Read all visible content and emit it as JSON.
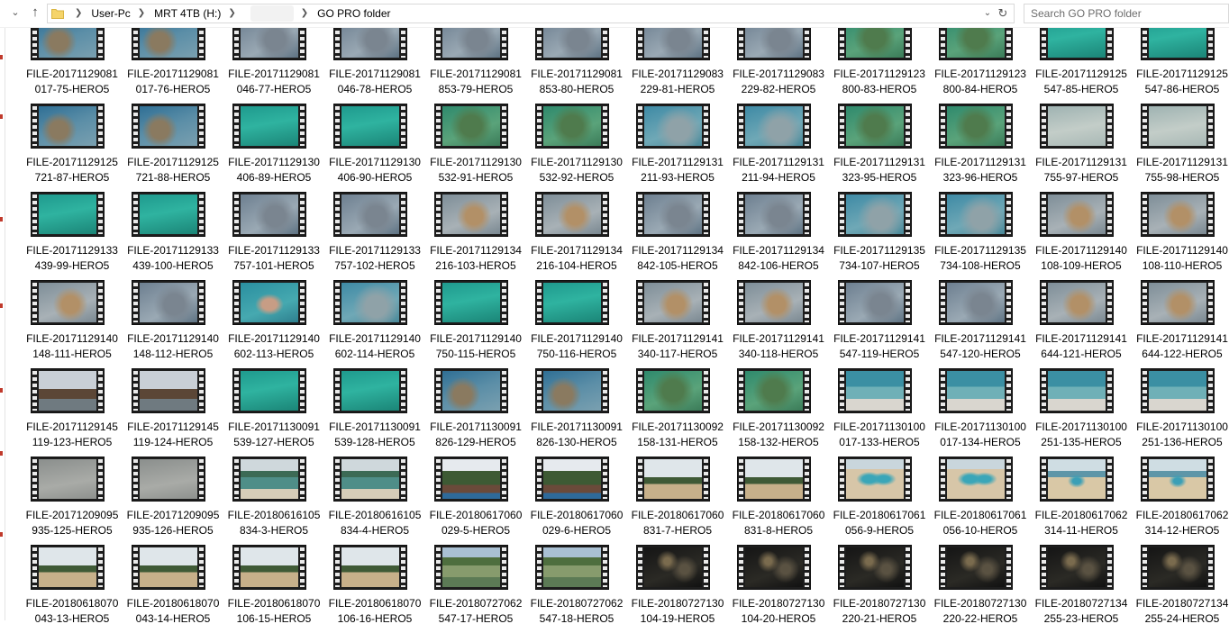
{
  "address_bar": {
    "breadcrumbs": [
      "User-Pc",
      "MRT 4TB (H:)",
      "GO PRO folder"
    ]
  },
  "search": {
    "placeholder": "Search GO PRO folder"
  },
  "files": [
    {
      "name": [
        "FILE-20171129081",
        "017-75-HERO5"
      ],
      "thumb": "reef"
    },
    {
      "name": [
        "FILE-20171129081",
        "017-76-HERO5"
      ],
      "thumb": "reef"
    },
    {
      "name": [
        "FILE-20171129081",
        "046-77-HERO5"
      ],
      "thumb": "rocks"
    },
    {
      "name": [
        "FILE-20171129081",
        "046-78-HERO5"
      ],
      "thumb": "rocks"
    },
    {
      "name": [
        "FILE-20171129081",
        "853-79-HERO5"
      ],
      "thumb": "rocks"
    },
    {
      "name": [
        "FILE-20171129081",
        "853-80-HERO5"
      ],
      "thumb": "rocks"
    },
    {
      "name": [
        "FILE-20171129083",
        "229-81-HERO5"
      ],
      "thumb": "rocks"
    },
    {
      "name": [
        "FILE-20171129083",
        "229-82-HERO5"
      ],
      "thumb": "rocks"
    },
    {
      "name": [
        "FILE-20171129123",
        "800-83-HERO5"
      ],
      "thumb": "green"
    },
    {
      "name": [
        "FILE-20171129123",
        "800-84-HERO5"
      ],
      "thumb": "green"
    },
    {
      "name": [
        "FILE-20171129125",
        "547-85-HERO5"
      ],
      "thumb": "teal"
    },
    {
      "name": [
        "FILE-20171129125",
        "547-86-HERO5"
      ],
      "thumb": "teal"
    },
    {
      "name": [
        "FILE-20171129125",
        "721-87-HERO5"
      ],
      "thumb": "reef"
    },
    {
      "name": [
        "FILE-20171129125",
        "721-88-HERO5"
      ],
      "thumb": "reef"
    },
    {
      "name": [
        "FILE-20171129130",
        "406-89-HERO5"
      ],
      "thumb": "teal"
    },
    {
      "name": [
        "FILE-20171129130",
        "406-90-HERO5"
      ],
      "thumb": "teal"
    },
    {
      "name": [
        "FILE-20171129130",
        "532-91-HERO5"
      ],
      "thumb": "green"
    },
    {
      "name": [
        "FILE-20171129130",
        "532-92-HERO5"
      ],
      "thumb": "green"
    },
    {
      "name": [
        "FILE-20171129131",
        "211-93-HERO5"
      ],
      "thumb": "water"
    },
    {
      "name": [
        "FILE-20171129131",
        "211-94-HERO5"
      ],
      "thumb": "water"
    },
    {
      "name": [
        "FILE-20171129131",
        "323-95-HERO5"
      ],
      "thumb": "green"
    },
    {
      "name": [
        "FILE-20171129131",
        "323-96-HERO5"
      ],
      "thumb": "green"
    },
    {
      "name": [
        "FILE-20171129131",
        "755-97-HERO5"
      ],
      "thumb": "sand"
    },
    {
      "name": [
        "FILE-20171129131",
        "755-98-HERO5"
      ],
      "thumb": "sand"
    },
    {
      "name": [
        "FILE-20171129133",
        "439-99-HERO5"
      ],
      "thumb": "teal"
    },
    {
      "name": [
        "FILE-20171129133",
        "439-100-HERO5"
      ],
      "thumb": "teal"
    },
    {
      "name": [
        "FILE-20171129133",
        "757-101-HERO5"
      ],
      "thumb": "rocks"
    },
    {
      "name": [
        "FILE-20171129133",
        "757-102-HERO5"
      ],
      "thumb": "rocks"
    },
    {
      "name": [
        "FILE-20171129134",
        "216-103-HERO5"
      ],
      "thumb": "coral"
    },
    {
      "name": [
        "FILE-20171129134",
        "216-104-HERO5"
      ],
      "thumb": "coral"
    },
    {
      "name": [
        "FILE-20171129134",
        "842-105-HERO5"
      ],
      "thumb": "rocks"
    },
    {
      "name": [
        "FILE-20171129134",
        "842-106-HERO5"
      ],
      "thumb": "rocks"
    },
    {
      "name": [
        "FILE-20171129135",
        "734-107-HERO5"
      ],
      "thumb": "water"
    },
    {
      "name": [
        "FILE-20171129135",
        "734-108-HERO5"
      ],
      "thumb": "water"
    },
    {
      "name": [
        "FILE-20171129140",
        "108-109-HERO5"
      ],
      "thumb": "coral"
    },
    {
      "name": [
        "FILE-20171129140",
        "108-110-HERO5"
      ],
      "thumb": "coral"
    },
    {
      "name": [
        "FILE-20171129140",
        "148-111-HERO5"
      ],
      "thumb": "coral"
    },
    {
      "name": [
        "FILE-20171129140",
        "148-112-HERO5"
      ],
      "thumb": "rocks"
    },
    {
      "name": [
        "FILE-20171129140",
        "602-113-HERO5"
      ],
      "thumb": "swimmer"
    },
    {
      "name": [
        "FILE-20171129140",
        "602-114-HERO5"
      ],
      "thumb": "water"
    },
    {
      "name": [
        "FILE-20171129140",
        "750-115-HERO5"
      ],
      "thumb": "teal"
    },
    {
      "name": [
        "FILE-20171129140",
        "750-116-HERO5"
      ],
      "thumb": "teal"
    },
    {
      "name": [
        "FILE-20171129141",
        "340-117-HERO5"
      ],
      "thumb": "coral"
    },
    {
      "name": [
        "FILE-20171129141",
        "340-118-HERO5"
      ],
      "thumb": "coral"
    },
    {
      "name": [
        "FILE-20171129141",
        "547-119-HERO5"
      ],
      "thumb": "rocks"
    },
    {
      "name": [
        "FILE-20171129141",
        "547-120-HERO5"
      ],
      "thumb": "rocks"
    },
    {
      "name": [
        "FILE-20171129141",
        "644-121-HERO5"
      ],
      "thumb": "coral"
    },
    {
      "name": [
        "FILE-20171129141",
        "644-122-HERO5"
      ],
      "thumb": "coral"
    },
    {
      "name": [
        "FILE-20171129145",
        "119-123-HERO5"
      ],
      "thumb": "villa"
    },
    {
      "name": [
        "FILE-20171129145",
        "119-124-HERO5"
      ],
      "thumb": "villa"
    },
    {
      "name": [
        "FILE-20171130091",
        "539-127-HERO5"
      ],
      "thumb": "teal"
    },
    {
      "name": [
        "FILE-20171130091",
        "539-128-HERO5"
      ],
      "thumb": "teal"
    },
    {
      "name": [
        "FILE-20171130091",
        "826-129-HERO5"
      ],
      "thumb": "reef"
    },
    {
      "name": [
        "FILE-20171130091",
        "826-130-HERO5"
      ],
      "thumb": "reef"
    },
    {
      "name": [
        "FILE-20171130092",
        "158-131-HERO5"
      ],
      "thumb": "green"
    },
    {
      "name": [
        "FILE-20171130092",
        "158-132-HERO5"
      ],
      "thumb": "green"
    },
    {
      "name": [
        "FILE-20171130100",
        "017-133-HERO5"
      ],
      "thumb": "shore"
    },
    {
      "name": [
        "FILE-20171130100",
        "017-134-HERO5"
      ],
      "thumb": "shore"
    },
    {
      "name": [
        "FILE-20171130100",
        "251-135-HERO5"
      ],
      "thumb": "shore"
    },
    {
      "name": [
        "FILE-20171130100",
        "251-136-HERO5"
      ],
      "thumb": "shore"
    },
    {
      "name": [
        "FILE-20171209095",
        "935-125-HERO5"
      ],
      "thumb": "grey"
    },
    {
      "name": [
        "FILE-20171209095",
        "935-126-HERO5"
      ],
      "thumb": "grey"
    },
    {
      "name": [
        "FILE-20180616105",
        "834-3-HERO5"
      ],
      "thumb": "lagoon"
    },
    {
      "name": [
        "FILE-20180616105",
        "834-4-HERO5"
      ],
      "thumb": "lagoon"
    },
    {
      "name": [
        "FILE-20180617060",
        "029-5-HERO5"
      ],
      "thumb": "resort"
    },
    {
      "name": [
        "FILE-20180617060",
        "029-6-HERO5"
      ],
      "thumb": "resort"
    },
    {
      "name": [
        "FILE-20180617060",
        "831-7-HERO5"
      ],
      "thumb": "palms"
    },
    {
      "name": [
        "FILE-20180617060",
        "831-8-HERO5"
      ],
      "thumb": "palms"
    },
    {
      "name": [
        "FILE-20180617061",
        "056-9-HERO5"
      ],
      "thumb": "people"
    },
    {
      "name": [
        "FILE-20180617061",
        "056-10-HERO5"
      ],
      "thumb": "people"
    },
    {
      "name": [
        "FILE-20180617062",
        "314-11-HERO5"
      ],
      "thumb": "beachgirl"
    },
    {
      "name": [
        "FILE-20180617062",
        "314-12-HERO5"
      ],
      "thumb": "beachgirl"
    },
    {
      "name": [
        "FILE-20180618070",
        "043-13-HERO5"
      ],
      "thumb": "palms"
    },
    {
      "name": [
        "FILE-20180618070",
        "043-14-HERO5"
      ],
      "thumb": "palms"
    },
    {
      "name": [
        "FILE-20180618070",
        "106-15-HERO5"
      ],
      "thumb": "palms"
    },
    {
      "name": [
        "FILE-20180618070",
        "106-16-HERO5"
      ],
      "thumb": "palms"
    },
    {
      "name": [
        "FILE-20180727062",
        "547-17-HERO5"
      ],
      "thumb": "lake"
    },
    {
      "name": [
        "FILE-20180727062",
        "547-18-HERO5"
      ],
      "thumb": "lake"
    },
    {
      "name": [
        "FILE-20180727130",
        "104-19-HERO5"
      ],
      "thumb": "dark"
    },
    {
      "name": [
        "FILE-20180727130",
        "104-20-HERO5"
      ],
      "thumb": "dark"
    },
    {
      "name": [
        "FILE-20180727130",
        "220-21-HERO5"
      ],
      "thumb": "dark"
    },
    {
      "name": [
        "FILE-20180727130",
        "220-22-HERO5"
      ],
      "thumb": "dark"
    },
    {
      "name": [
        "FILE-20180727134",
        "255-23-HERO5"
      ],
      "thumb": "dark"
    },
    {
      "name": [
        "FILE-20180727134",
        "255-24-HERO5"
      ],
      "thumb": "dark"
    }
  ]
}
